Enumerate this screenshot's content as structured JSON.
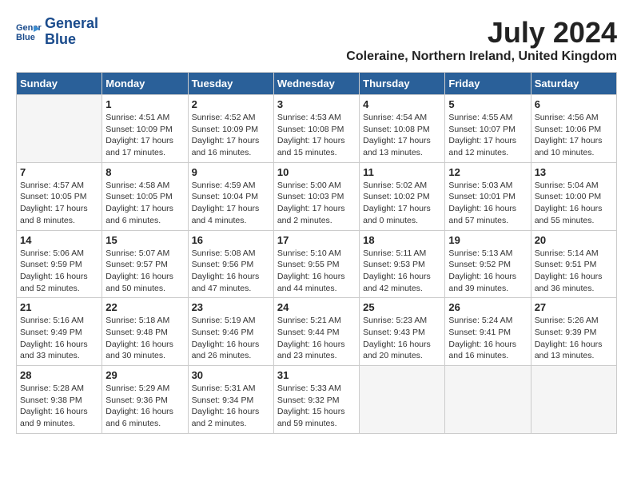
{
  "header": {
    "logo_line1": "General",
    "logo_line2": "Blue",
    "title": "July 2024",
    "subtitle": "Coleraine, Northern Ireland, United Kingdom"
  },
  "columns": [
    "Sunday",
    "Monday",
    "Tuesday",
    "Wednesday",
    "Thursday",
    "Friday",
    "Saturday"
  ],
  "weeks": [
    [
      {
        "day": "",
        "info": ""
      },
      {
        "day": "1",
        "info": "Sunrise: 4:51 AM\nSunset: 10:09 PM\nDaylight: 17 hours\nand 17 minutes."
      },
      {
        "day": "2",
        "info": "Sunrise: 4:52 AM\nSunset: 10:09 PM\nDaylight: 17 hours\nand 16 minutes."
      },
      {
        "day": "3",
        "info": "Sunrise: 4:53 AM\nSunset: 10:08 PM\nDaylight: 17 hours\nand 15 minutes."
      },
      {
        "day": "4",
        "info": "Sunrise: 4:54 AM\nSunset: 10:08 PM\nDaylight: 17 hours\nand 13 minutes."
      },
      {
        "day": "5",
        "info": "Sunrise: 4:55 AM\nSunset: 10:07 PM\nDaylight: 17 hours\nand 12 minutes."
      },
      {
        "day": "6",
        "info": "Sunrise: 4:56 AM\nSunset: 10:06 PM\nDaylight: 17 hours\nand 10 minutes."
      }
    ],
    [
      {
        "day": "7",
        "info": "Sunrise: 4:57 AM\nSunset: 10:05 PM\nDaylight: 17 hours\nand 8 minutes."
      },
      {
        "day": "8",
        "info": "Sunrise: 4:58 AM\nSunset: 10:05 PM\nDaylight: 17 hours\nand 6 minutes."
      },
      {
        "day": "9",
        "info": "Sunrise: 4:59 AM\nSunset: 10:04 PM\nDaylight: 17 hours\nand 4 minutes."
      },
      {
        "day": "10",
        "info": "Sunrise: 5:00 AM\nSunset: 10:03 PM\nDaylight: 17 hours\nand 2 minutes."
      },
      {
        "day": "11",
        "info": "Sunrise: 5:02 AM\nSunset: 10:02 PM\nDaylight: 17 hours\nand 0 minutes."
      },
      {
        "day": "12",
        "info": "Sunrise: 5:03 AM\nSunset: 10:01 PM\nDaylight: 16 hours\nand 57 minutes."
      },
      {
        "day": "13",
        "info": "Sunrise: 5:04 AM\nSunset: 10:00 PM\nDaylight: 16 hours\nand 55 minutes."
      }
    ],
    [
      {
        "day": "14",
        "info": "Sunrise: 5:06 AM\nSunset: 9:59 PM\nDaylight: 16 hours\nand 52 minutes."
      },
      {
        "day": "15",
        "info": "Sunrise: 5:07 AM\nSunset: 9:57 PM\nDaylight: 16 hours\nand 50 minutes."
      },
      {
        "day": "16",
        "info": "Sunrise: 5:08 AM\nSunset: 9:56 PM\nDaylight: 16 hours\nand 47 minutes."
      },
      {
        "day": "17",
        "info": "Sunrise: 5:10 AM\nSunset: 9:55 PM\nDaylight: 16 hours\nand 44 minutes."
      },
      {
        "day": "18",
        "info": "Sunrise: 5:11 AM\nSunset: 9:53 PM\nDaylight: 16 hours\nand 42 minutes."
      },
      {
        "day": "19",
        "info": "Sunrise: 5:13 AM\nSunset: 9:52 PM\nDaylight: 16 hours\nand 39 minutes."
      },
      {
        "day": "20",
        "info": "Sunrise: 5:14 AM\nSunset: 9:51 PM\nDaylight: 16 hours\nand 36 minutes."
      }
    ],
    [
      {
        "day": "21",
        "info": "Sunrise: 5:16 AM\nSunset: 9:49 PM\nDaylight: 16 hours\nand 33 minutes."
      },
      {
        "day": "22",
        "info": "Sunrise: 5:18 AM\nSunset: 9:48 PM\nDaylight: 16 hours\nand 30 minutes."
      },
      {
        "day": "23",
        "info": "Sunrise: 5:19 AM\nSunset: 9:46 PM\nDaylight: 16 hours\nand 26 minutes."
      },
      {
        "day": "24",
        "info": "Sunrise: 5:21 AM\nSunset: 9:44 PM\nDaylight: 16 hours\nand 23 minutes."
      },
      {
        "day": "25",
        "info": "Sunrise: 5:23 AM\nSunset: 9:43 PM\nDaylight: 16 hours\nand 20 minutes."
      },
      {
        "day": "26",
        "info": "Sunrise: 5:24 AM\nSunset: 9:41 PM\nDaylight: 16 hours\nand 16 minutes."
      },
      {
        "day": "27",
        "info": "Sunrise: 5:26 AM\nSunset: 9:39 PM\nDaylight: 16 hours\nand 13 minutes."
      }
    ],
    [
      {
        "day": "28",
        "info": "Sunrise: 5:28 AM\nSunset: 9:38 PM\nDaylight: 16 hours\nand 9 minutes."
      },
      {
        "day": "29",
        "info": "Sunrise: 5:29 AM\nSunset: 9:36 PM\nDaylight: 16 hours\nand 6 minutes."
      },
      {
        "day": "30",
        "info": "Sunrise: 5:31 AM\nSunset: 9:34 PM\nDaylight: 16 hours\nand 2 minutes."
      },
      {
        "day": "31",
        "info": "Sunrise: 5:33 AM\nSunset: 9:32 PM\nDaylight: 15 hours\nand 59 minutes."
      },
      {
        "day": "",
        "info": ""
      },
      {
        "day": "",
        "info": ""
      },
      {
        "day": "",
        "info": ""
      }
    ]
  ]
}
